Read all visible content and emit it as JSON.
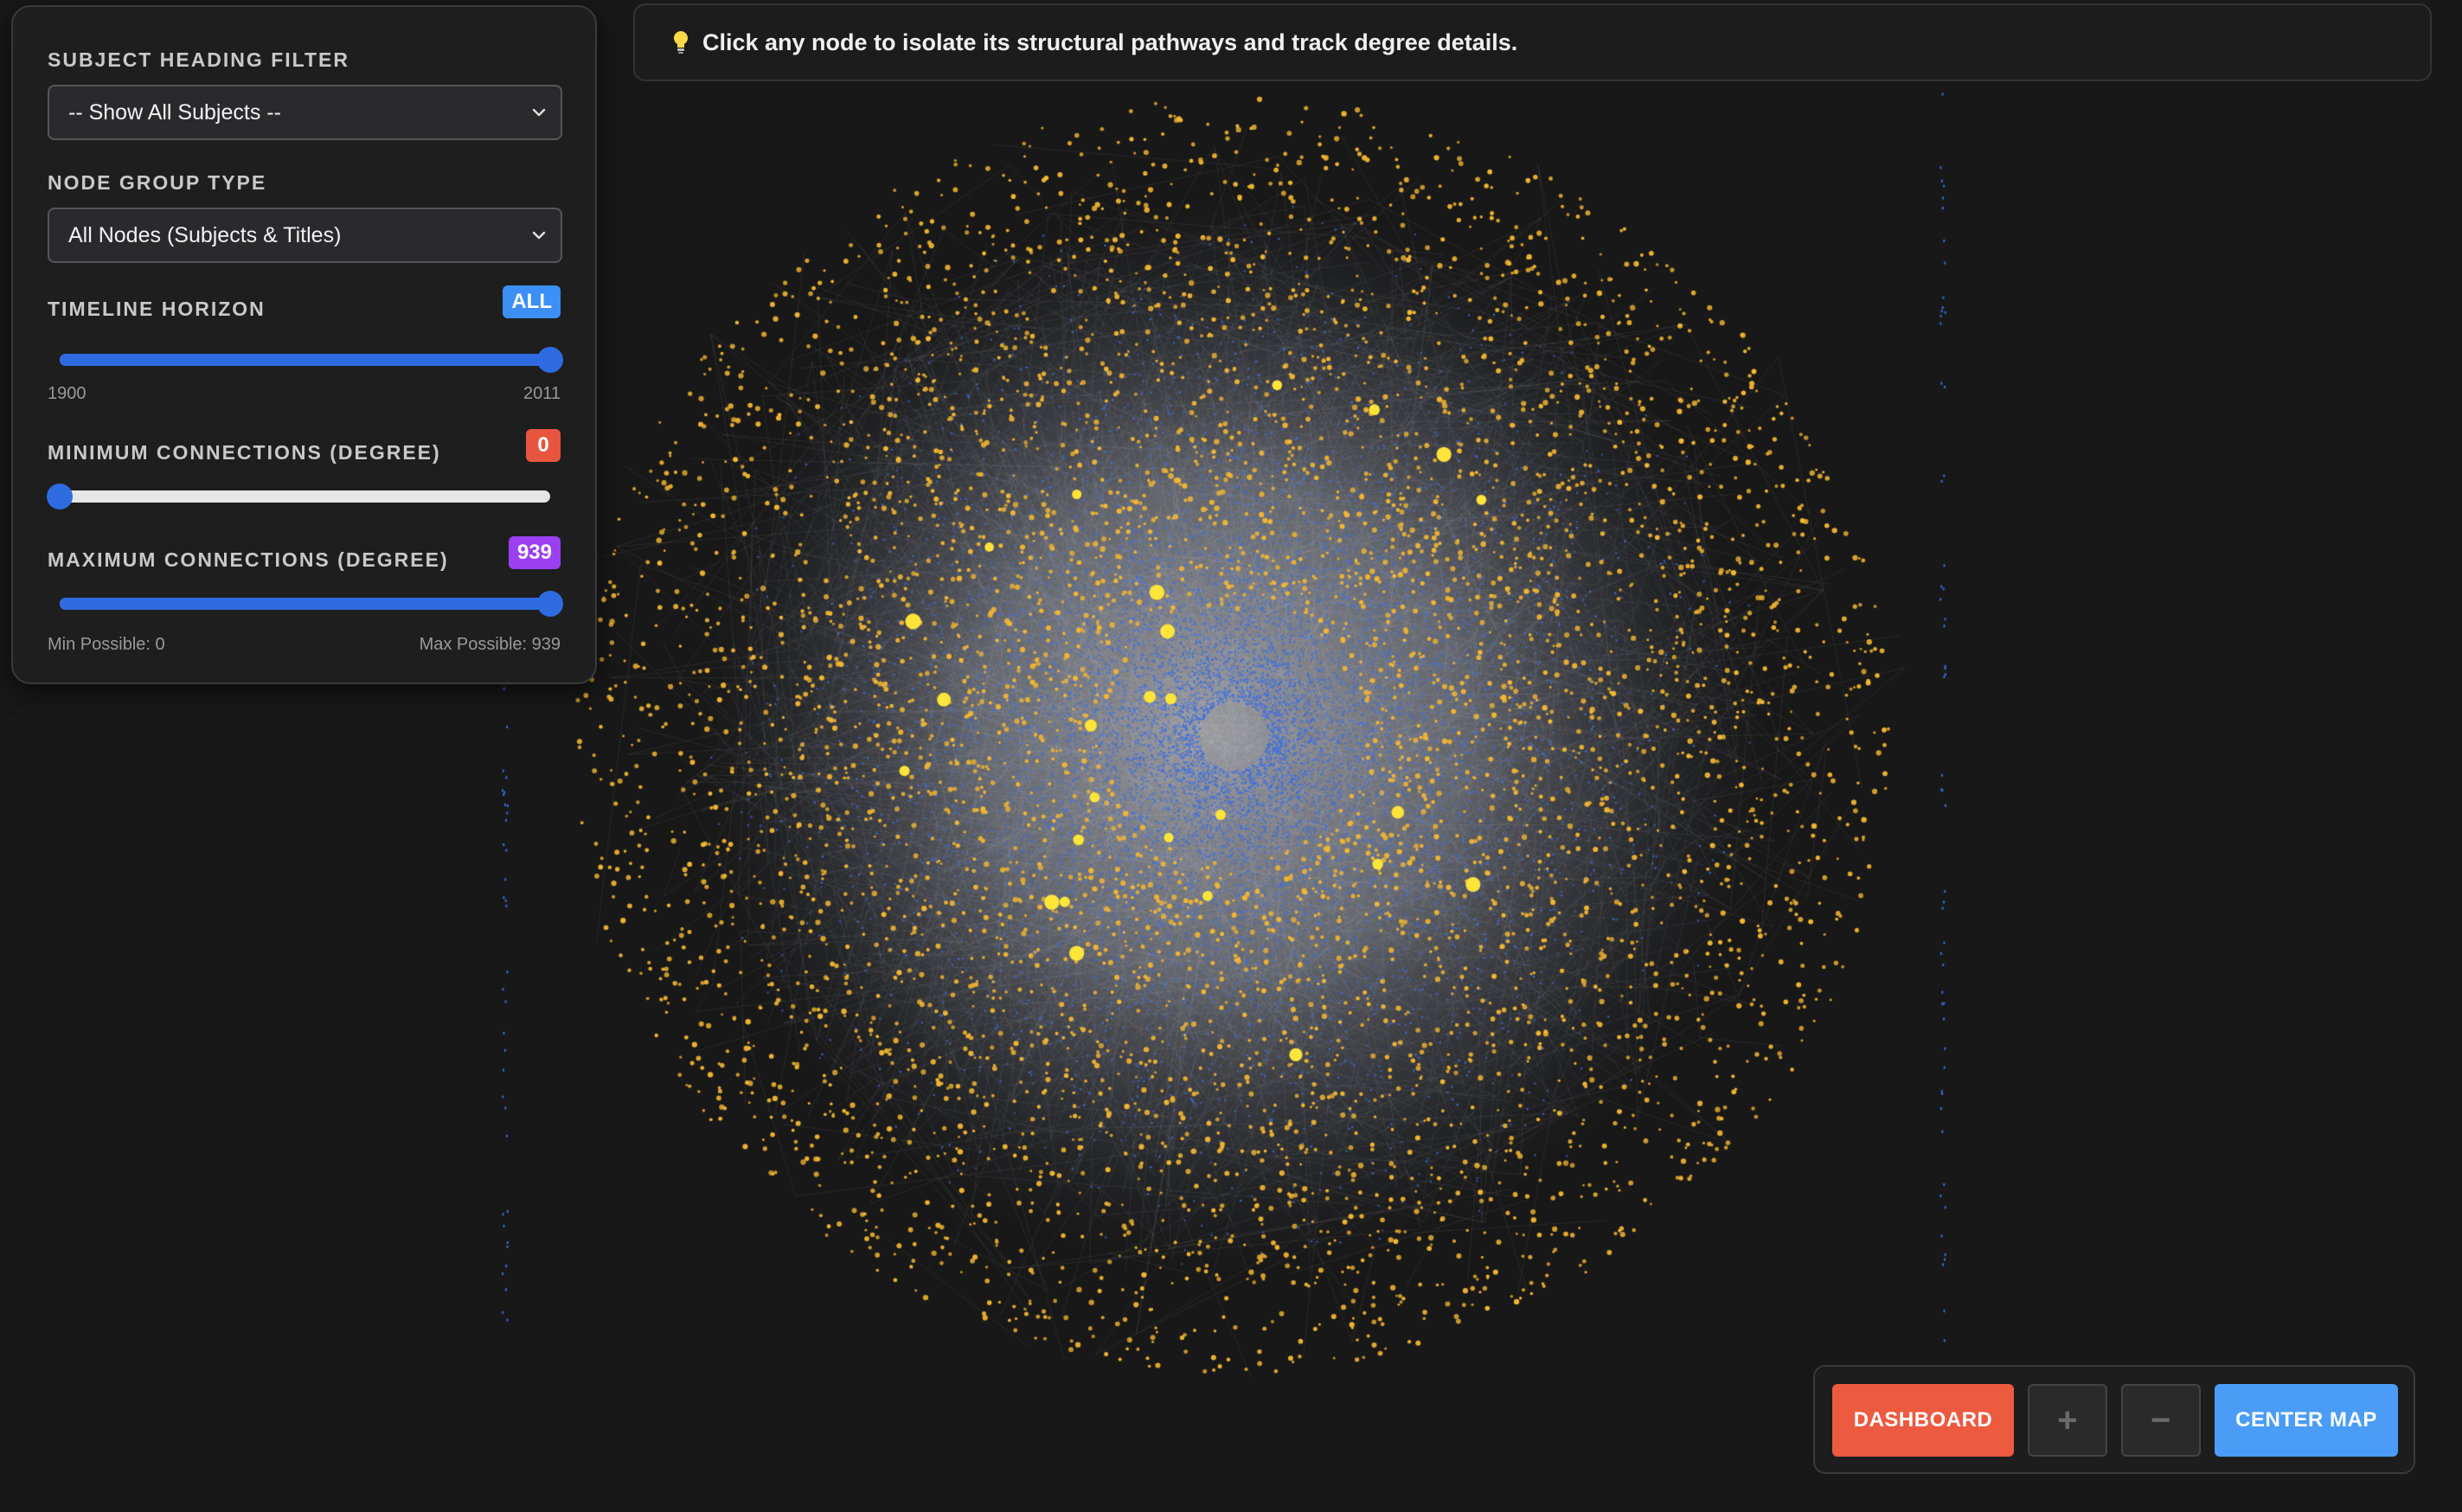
{
  "controls": {
    "subject_filter": {
      "label": "SUBJECT HEADING FILTER",
      "selected": "-- Show All Subjects --"
    },
    "node_group": {
      "label": "NODE GROUP TYPE",
      "selected": "All Nodes (Subjects & Titles)"
    },
    "timeline": {
      "label": "TIMELINE HORIZON",
      "badge": "ALL",
      "badge_color": "#3b8ff5",
      "min_label": "1900",
      "max_label": "2011",
      "min": 1900,
      "max": 2011,
      "value": 2011
    },
    "min_degree": {
      "label": "MINIMUM CONNECTIONS (DEGREE)",
      "badge": "0",
      "badge_color": "#e8553e",
      "min": 0,
      "max": 939,
      "value": 0
    },
    "max_degree": {
      "label": "MAXIMUM CONNECTIONS (DEGREE)",
      "badge": "939",
      "badge_color": "#9b3ff0",
      "min": 0,
      "max": 939,
      "value": 939,
      "min_possible": "Min Possible: 0",
      "max_possible": "Max Possible: 939"
    }
  },
  "hint": {
    "icon": "lightbulb-icon",
    "text": "Click any node to isolate its structural pathways and track degree details."
  },
  "map_controls": {
    "dashboard": "DASHBOARD",
    "zoom_in": "+",
    "zoom_out": "−",
    "center": "CENTER MAP"
  },
  "colors": {
    "background": "#181818",
    "subject_node": "#f5b731",
    "hub_node": "#ffe43a",
    "title_node": "#3d6fe0",
    "edge": "#9a9a9a",
    "accent_blue": "#2f6be0"
  }
}
